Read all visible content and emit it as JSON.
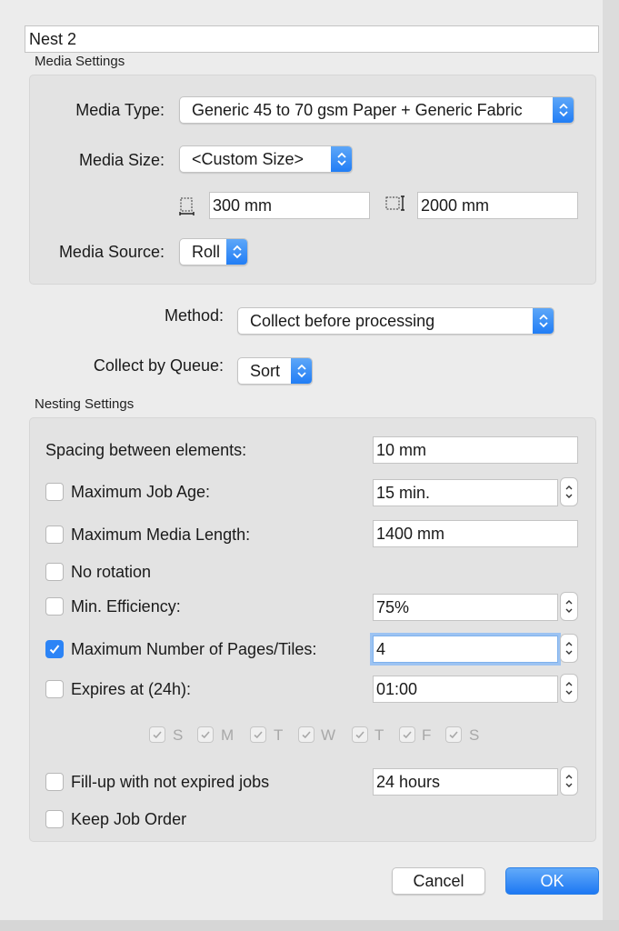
{
  "job_name": "Nest 2",
  "media_settings": {
    "group_title": "Media Settings",
    "media_type": {
      "label": "Media Type:",
      "value": "Generic 45 to 70 gsm Paper + Generic Fabric"
    },
    "media_size": {
      "label": "Media Size:",
      "value": "<Custom Size>"
    },
    "width": {
      "value": "300 mm",
      "icon": "width-dimension-icon"
    },
    "height": {
      "value": "2000 mm",
      "icon": "height-dimension-icon"
    },
    "media_source": {
      "label": "Media Source:",
      "value": "Roll"
    }
  },
  "method": {
    "label": "Method:",
    "value": "Collect before processing"
  },
  "collect_by_queue": {
    "label": "Collect by Queue:",
    "value": "Sort"
  },
  "nesting_settings": {
    "group_title": "Nesting Settings",
    "spacing": {
      "label": "Spacing between elements:",
      "value": "10 mm"
    },
    "max_job_age": {
      "label": "Maximum Job Age:",
      "value": "15 min.",
      "checked": false
    },
    "max_media_length": {
      "label": "Maximum Media Length:",
      "value": "1400 mm",
      "checked": false
    },
    "no_rotation": {
      "label": "No rotation",
      "checked": false
    },
    "min_efficiency": {
      "label": "Min. Efficiency:",
      "value": "75%",
      "checked": false
    },
    "max_pages": {
      "label": "Maximum Number of Pages/Tiles:",
      "value": "4",
      "checked": true
    },
    "expires_at": {
      "label": "Expires at (24h):",
      "value": "01:00",
      "checked": false
    },
    "days": [
      "S",
      "M",
      "T",
      "W",
      "T",
      "F",
      "S"
    ],
    "fill_up": {
      "label": "Fill-up with not expired jobs",
      "value": "24 hours",
      "checked": false
    },
    "keep_order": {
      "label": "Keep Job Order",
      "checked": false
    }
  },
  "buttons": {
    "cancel": "Cancel",
    "ok": "OK"
  },
  "colors": {
    "accent": "#2c84f6",
    "panel": "#e3e3e3",
    "background": "#ececec"
  }
}
